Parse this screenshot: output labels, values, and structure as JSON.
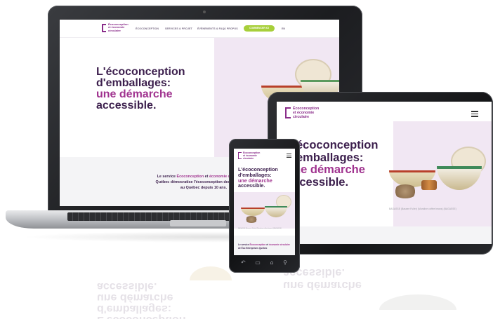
{
  "site": {
    "logo_text": "Écoconception\net économie\ncirculaire",
    "nav": [
      "ÉCOCONCEPTION",
      "SERVICES & PROJET",
      "ÉVÈNEMENTS & FAQ",
      "À PROPOS"
    ],
    "cta": "COMMENCER ICI",
    "language": "EN",
    "hero": {
      "line1": "L'écoconception",
      "line2": "d'emballages:",
      "line3": "une démarche",
      "line4": "accessible."
    },
    "intro": {
      "part1": "Le service ",
      "accent1": "Écoconception",
      "part2": " et ",
      "accent2": "économie circulaire",
      "part3": " de",
      "line2": "Québec démocratise l'écoconception des emballages",
      "line3": "au Québec depuis 10 ans."
    },
    "photo_credit": "BAGASSE (Bassee Fuller) (Mundine coffee beans) (BAGASSE)"
  },
  "phone_intro": {
    "part1": "Le service ",
    "accent1": "Écoconception",
    "part2": " et ",
    "accent2": "économie circulaire",
    "line2": "de Éco Entreprises Québec"
  },
  "phone_nav_icons": [
    "back-icon",
    "menu-icon",
    "home-icon",
    "search-icon"
  ],
  "phone_nav_glyphs": [
    "↶",
    "▭",
    "⌂",
    "⚲"
  ],
  "colors": {
    "brand_purple": "#3c1f4d",
    "accent_magenta": "#a0338f",
    "cta_green": "#a7cf3a",
    "hero_bg": "#f1e7f3"
  }
}
